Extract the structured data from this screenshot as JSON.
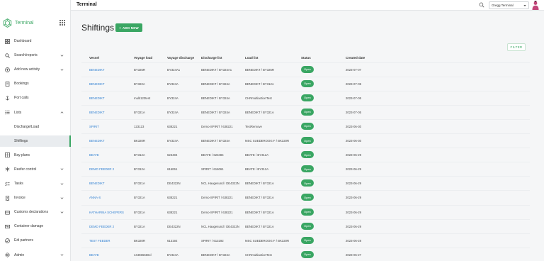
{
  "app": {
    "brand": "Terminal",
    "page_header": "Terminal",
    "account": "Gregg Terminal"
  },
  "sidebar": {
    "items": [
      {
        "label": "Dashboard",
        "icon": "dashboard-icon",
        "chevron": false
      },
      {
        "label": "Search/reports",
        "icon": "search-icon",
        "chevron": true
      },
      {
        "label": "Add new activity",
        "icon": "plus-circle-icon",
        "chevron": true
      },
      {
        "label": "Bookings",
        "icon": "book-icon",
        "chevron": false
      },
      {
        "label": "Port calls",
        "icon": "anchor-icon",
        "chevron": false
      },
      {
        "label": "Lists",
        "icon": "list-icon",
        "chevron": true,
        "expanded": true
      },
      {
        "label": "Discharge/Load",
        "sub": true
      },
      {
        "label": "Shiftings",
        "sub": true,
        "active": true
      },
      {
        "label": "Bay plans",
        "icon": "grid-icon",
        "chevron": false
      },
      {
        "label": "Reefer control",
        "icon": "snowflake-icon",
        "chevron": true
      },
      {
        "label": "Tasks",
        "icon": "tasks-icon",
        "chevron": true
      },
      {
        "label": "Invoice",
        "icon": "invoice-icon",
        "chevron": true
      },
      {
        "label": "Customs declarations",
        "icon": "customs-icon",
        "chevron": true
      },
      {
        "label": "Container damage",
        "icon": "damage-icon",
        "chevron": false
      },
      {
        "label": "Edi partners",
        "icon": "partners-icon",
        "chevron": false
      },
      {
        "label": "Admin",
        "icon": "gear-icon",
        "chevron": true
      }
    ]
  },
  "main": {
    "title": "Shiftings",
    "add_label": "ADD NEW",
    "filter_label": "FILTER",
    "columns": [
      "Vessel",
      "Voyage load",
      "Voyage discharge",
      "Discharge list",
      "Load list",
      "Status",
      "Created date"
    ],
    "rows": [
      [
        "BENEDIKT",
        "BY325R",
        "BY324A1",
        "BENEDIKT / BY324A1",
        "BENEDIKT / BY325R",
        "Open",
        "2023-07-07"
      ],
      [
        "BENEDIKT",
        "BY322A",
        "BY324A",
        "BENEDIKT / BY324A",
        "BENEDIKT / BY312A",
        "Open",
        "2023-07-05"
      ],
      [
        "BENEDIKT",
        "multi123test",
        "BY324A",
        "BENEDIKT / BY324A",
        "CHRmultiactionTest",
        "Open",
        "2023-07-05"
      ],
      [
        "BENEDIKT",
        "BY321A",
        "BY324A",
        "BENEDIKT / BY324A",
        "BENEDIKT / BY321A",
        "Open",
        "2023-07-05"
      ],
      [
        "SPIRIT",
        "123123",
        "638221",
        "Demo-SPIRIT / 638221",
        "TestRemove",
        "Open",
        "2023-06-30"
      ],
      [
        "BENEDIKT",
        "BK320R",
        "BY324A",
        "BENEDIKT / BY324A",
        "MSC SUEDEROOG F / BK320R",
        "Open",
        "2023-06-30"
      ],
      [
        "BEATE",
        "BY312A",
        "623484",
        "BEATE / 623484",
        "BEATE / BY312A",
        "Open",
        "2023-06-29"
      ],
      [
        "DEMO FEEDER 2",
        "BY312A",
        "616061",
        "SPIRIT / 616061",
        "BEATE / BY312A",
        "Open",
        "2023-06-29"
      ],
      [
        "BENEDIKT",
        "BY321A",
        "DE4322N",
        "NCL Haugesund / DE4322N",
        "BENEDIKT / BY321A",
        "Open",
        "2023-06-29"
      ],
      [
        "ANNA-S",
        "BY321A",
        "638221",
        "Demo-SPIRIT / 638221",
        "BENEDIKT / BY321A",
        "Open",
        "2023-06-29"
      ],
      [
        "KATHARINA SCHEPERS",
        "BY321A",
        "638221",
        "Demo-SPIRIT / 638221",
        "BENEDIKT / BY321A",
        "Open",
        "2023-06-29"
      ],
      [
        "DEMO FEEDER 2",
        "BY321A",
        "DE4322N",
        "NCL Haugesund / DE4322N",
        "BENEDIKT / BY321A",
        "Open",
        "2023-06-29"
      ],
      [
        "TEST FEEDER",
        "BK320R",
        "613192",
        "SPIRIT / 613192",
        "MSC SUEDEROOG F / BK320R",
        "Open",
        "2023-06-28"
      ],
      [
        "BEATE",
        "444555666cl",
        "BY324A",
        "BENEDIKT / BY324A",
        "CHRmultiactionTest",
        "Open",
        "2023-06-27"
      ]
    ]
  },
  "colors": {
    "brand": "#3aa663",
    "link": "#2f7fd1"
  }
}
